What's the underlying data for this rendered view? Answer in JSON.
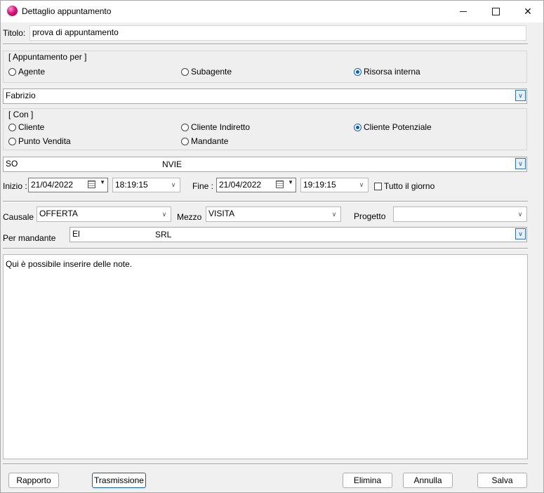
{
  "window": {
    "title": "Dettaglio appuntamento",
    "min_icon": "minimize-icon",
    "max_icon": "maximize-icon",
    "close_icon": "close-icon"
  },
  "titolo": {
    "label": "Titolo:",
    "value": "prova di appuntamento"
  },
  "appuntamento_per": {
    "legend": "[ Appuntamento per ]",
    "options": [
      {
        "label": "Agente",
        "checked": false
      },
      {
        "label": "Subagente",
        "checked": false
      },
      {
        "label": "Risorsa interna",
        "checked": true
      }
    ]
  },
  "risorsa": {
    "value": "Fabrizio"
  },
  "con": {
    "legend": "[ Con ]",
    "options": [
      {
        "label": "Cliente",
        "checked": false
      },
      {
        "label": "Cliente Indiretto",
        "checked": false
      },
      {
        "label": "Cliente Potenziale",
        "checked": true
      },
      {
        "label": "Punto Vendita",
        "checked": false
      },
      {
        "label": "Mandante",
        "checked": false
      }
    ]
  },
  "contatto": {
    "value_start": "SO",
    "value_end": "NVIE"
  },
  "inizio": {
    "label": "Inizio :",
    "date": "21/04/2022",
    "time": "18:19:15"
  },
  "fine": {
    "label": "Fine :",
    "date": "21/04/2022",
    "time": "19:19:15"
  },
  "tutto_giorno": {
    "label": "Tutto il giorno",
    "checked": false
  },
  "causale": {
    "label": "Causale",
    "value": "OFFERTA"
  },
  "mezzo": {
    "label": "Mezzo",
    "value": "VISITA"
  },
  "progetto": {
    "label": "Progetto",
    "value": ""
  },
  "mandante": {
    "label": "Per mandante",
    "value_start": "El",
    "value_end": "SRL"
  },
  "notes": {
    "value": "Qui è possibile inserire delle note."
  },
  "buttons": {
    "rapporto": "Rapporto",
    "trasmissione": "Trasmissione",
    "elimina": "Elimina",
    "annulla": "Annulla",
    "salva": "Salva"
  }
}
